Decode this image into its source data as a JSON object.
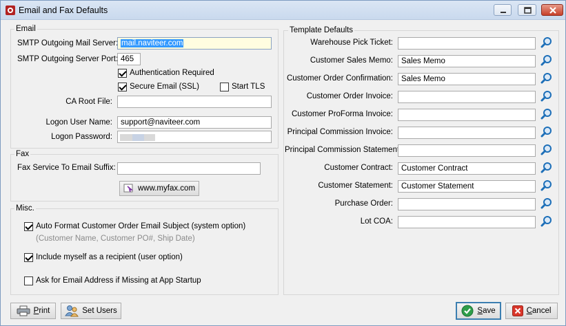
{
  "window": {
    "title": "Email and Fax Defaults"
  },
  "email": {
    "group_title": "Email",
    "smtp_server_label": "SMTP Outgoing Mail Server:",
    "smtp_server_value": "mail.naviteer.com",
    "smtp_port_label": "SMTP Outgoing Server Port:",
    "smtp_port_value": "465",
    "auth_required_label": "Authentication Required",
    "auth_required_checked": true,
    "secure_ssl_label": "Secure Email (SSL)",
    "secure_ssl_checked": true,
    "start_tls_label": "Start TLS",
    "start_tls_checked": false,
    "ca_root_label": "CA Root File:",
    "ca_root_value": "",
    "logon_user_label": "Logon User Name:",
    "logon_user_value": "support@naviteer.com",
    "logon_password_label": "Logon Password:"
  },
  "fax": {
    "group_title": "Fax",
    "suffix_label": "Fax Service To Email Suffix:",
    "suffix_value": "",
    "myfax_button": "www.myfax.com"
  },
  "misc": {
    "group_title": "Misc.",
    "auto_format_label": "Auto Format Customer Order Email Subject (system option)",
    "auto_format_checked": true,
    "auto_format_hint": "(Customer Name, Customer PO#, Ship Date)",
    "include_myself_label": "Include myself as a recipient (user option)",
    "include_myself_checked": true,
    "ask_email_label": "Ask for Email Address if Missing at App Startup",
    "ask_email_checked": false
  },
  "templates": {
    "group_title": "Template Defaults",
    "rows": [
      {
        "label": "Warehouse Pick Ticket:",
        "value": ""
      },
      {
        "label": "Customer Sales Memo:",
        "value": "Sales Memo"
      },
      {
        "label": "Customer Order Confirmation:",
        "value": "Sales Memo"
      },
      {
        "label": "Customer Order Invoice:",
        "value": ""
      },
      {
        "label": "Customer ProForma Invoice:",
        "value": ""
      },
      {
        "label": "Principal Commission Invoice:",
        "value": ""
      },
      {
        "label": "Principal Commission Statement:",
        "value": ""
      },
      {
        "label": "Customer Contract:",
        "value": "Customer Contract"
      },
      {
        "label": "Customer Statement:",
        "value": "Customer Statement"
      },
      {
        "label": "Purchase Order:",
        "value": ""
      },
      {
        "label": "Lot COA:",
        "value": ""
      }
    ]
  },
  "footer": {
    "print_hot": "P",
    "print_rest": "rint",
    "set_users_label": "Set Users",
    "save_hot": "S",
    "save_rest": "ave",
    "cancel_hot": "C",
    "cancel_rest": "ancel"
  },
  "colors": {
    "accent": "#1d6fb8",
    "selection": "#3399ff",
    "focus_bg": "#fffde0"
  },
  "icons": [
    "app-icon",
    "minimize-icon",
    "maximize-icon",
    "close-icon",
    "web-link-icon",
    "search-icon",
    "printer-icon",
    "users-icon",
    "checkmark-icon",
    "cancel-x-icon"
  ]
}
